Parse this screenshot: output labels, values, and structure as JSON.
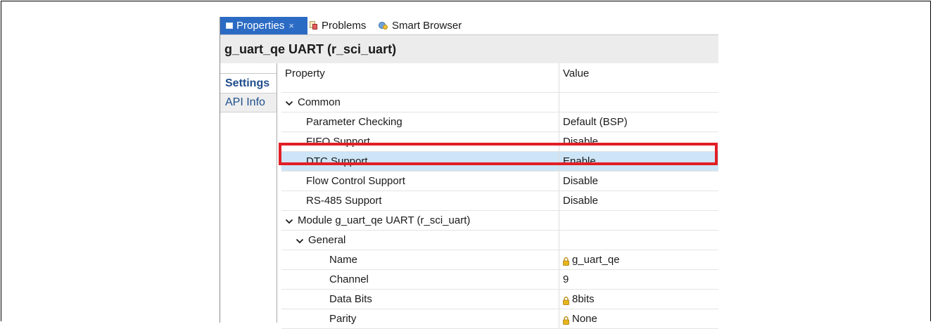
{
  "tabs": {
    "properties": "Properties",
    "close_glyph": "×",
    "problems": "Problems",
    "smart_browser": "Smart Browser"
  },
  "title": "g_uart_qe UART (r_sci_uart)",
  "side_tabs": {
    "settings": "Settings",
    "api_info": "API Info"
  },
  "table": {
    "col_property": "Property",
    "col_value": "Value",
    "common": "Common",
    "rows_common": [
      {
        "property": "Parameter Checking",
        "value": "Default (BSP)"
      },
      {
        "property": "FIFO Support",
        "value": "Disable"
      },
      {
        "property": "DTC Support",
        "value": "Enable"
      },
      {
        "property": "Flow Control Support",
        "value": "Disable"
      },
      {
        "property": "RS-485 Support",
        "value": "Disable"
      }
    ],
    "module": "Module g_uart_qe UART (r_sci_uart)",
    "general": "General",
    "rows_general": [
      {
        "property": "Name",
        "value": "g_uart_qe",
        "locked": true
      },
      {
        "property": "Channel",
        "value": "9",
        "locked": false
      },
      {
        "property": "Data Bits",
        "value": "8bits",
        "locked": true
      },
      {
        "property": "Parity",
        "value": "None",
        "locked": true
      }
    ]
  },
  "colors": {
    "active_tab": "#2b6bc4",
    "selection": "#cde5f7",
    "highlight_border": "#e11f26"
  }
}
